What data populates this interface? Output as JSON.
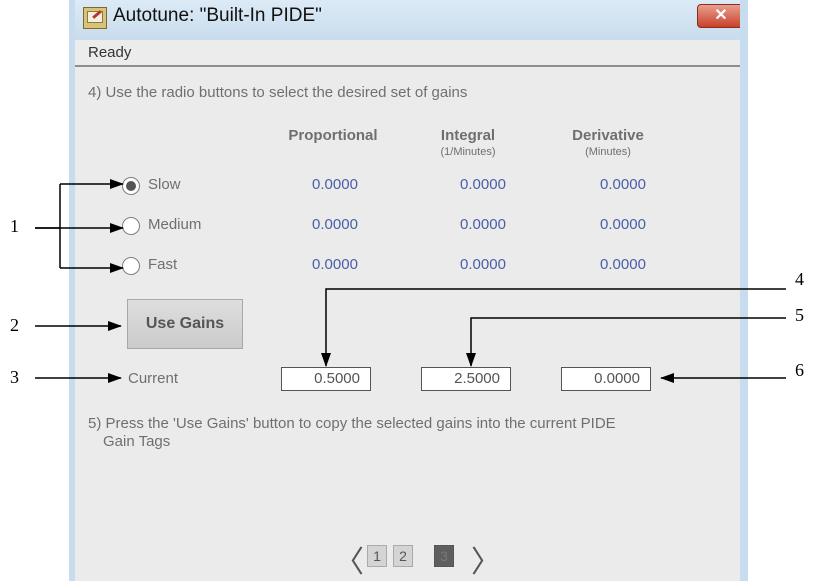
{
  "window": {
    "title": "Autotune:  \"Built-In PIDE\"",
    "close_label": "✕",
    "status": "Ready"
  },
  "step4": "4) Use the radio buttons to select the desired set of gains",
  "headers": {
    "proportional": "Proportional",
    "integral": "Integral",
    "integral_unit": "(1/Minutes)",
    "derivative": "Derivative",
    "derivative_unit": "(Minutes)"
  },
  "rows": [
    {
      "label": "Slow",
      "selected": true,
      "p": "0.0000",
      "i": "0.0000",
      "d": "0.0000"
    },
    {
      "label": "Medium",
      "selected": false,
      "p": "0.0000",
      "i": "0.0000",
      "d": "0.0000"
    },
    {
      "label": "Fast",
      "selected": false,
      "p": "0.0000",
      "i": "0.0000",
      "d": "0.0000"
    }
  ],
  "use_gains_label": "Use Gains",
  "current": {
    "label": "Current",
    "p": "0.5000",
    "i": "2.5000",
    "d": "0.0000"
  },
  "step5_line1": "5) Press the 'Use Gains' button to copy the selected gains into the current PIDE",
  "step5_line2": "Gain Tags",
  "pager": {
    "prev": "〈",
    "next": "〉",
    "pages": [
      "1",
      "2",
      "3"
    ],
    "current_page": "3"
  },
  "callouts": [
    "1",
    "2",
    "3",
    "4",
    "5",
    "6"
  ]
}
